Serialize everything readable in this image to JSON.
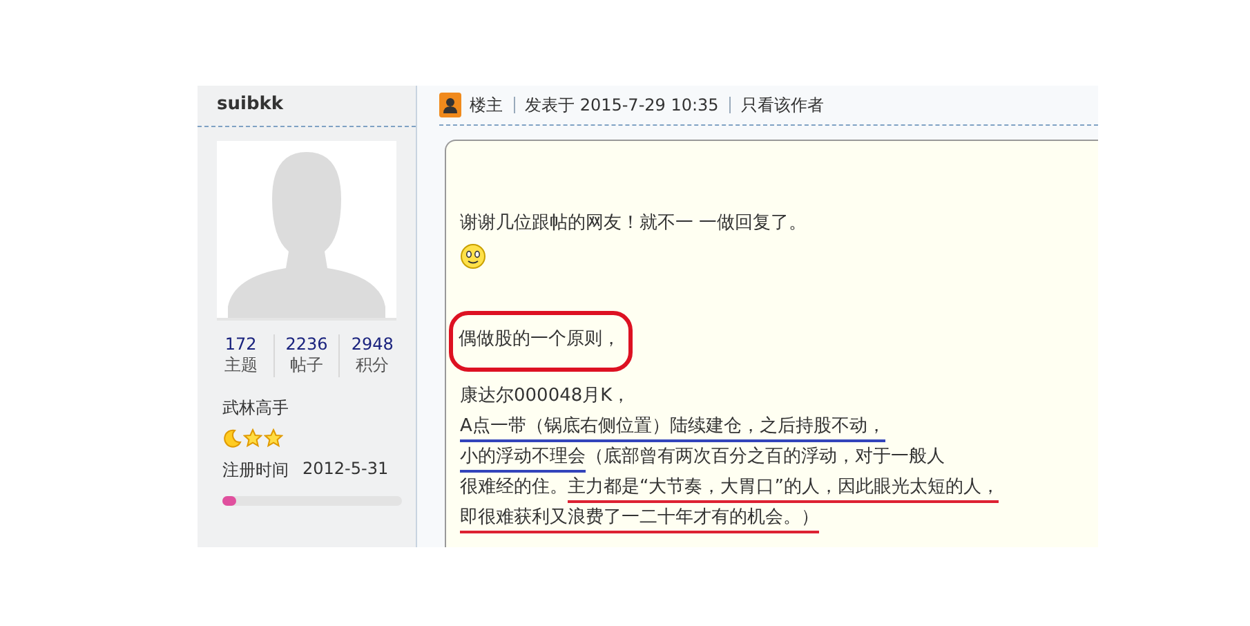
{
  "author": {
    "name": "suibkk",
    "stats": [
      {
        "value": "172",
        "label": "主题"
      },
      {
        "value": "2236",
        "label": "帖子"
      },
      {
        "value": "2948",
        "label": "积分"
      }
    ],
    "rank": "武林高手",
    "rank_icons": [
      {
        "kind": "moon"
      },
      {
        "kind": "star"
      },
      {
        "kind": "star"
      }
    ],
    "register_label": "注册时间",
    "register_date": "2012-5-31",
    "level": 0.08
  },
  "post": {
    "role": "楼主",
    "posted": "发表于 2015-7-29 10:35",
    "author_only": "只看该作者",
    "paragraphs": [
      {
        "kind": "text",
        "circled": false,
        "lines": [
          [
            {
              "text": "谢谢几位跟帖的网友！就不一 一做回复了。",
              "underline": false
            }
          ]
        ]
      },
      {
        "kind": "smiley"
      },
      {
        "kind": "text",
        "circled": true,
        "lines": [
          [
            {
              "text": "偶做股的一个原则，",
              "underline": false
            }
          ]
        ]
      },
      {
        "kind": "text",
        "circled": false,
        "lines": [
          [
            {
              "text": "康达尔000048月K，",
              "underline": false
            }
          ],
          [
            {
              "text": "A点一带（锅底右侧位置）陆续建仓，之后持股不动，",
              "underline": true,
              "color": "#3344bb"
            }
          ],
          [
            {
              "text": "小的浮动不理会",
              "underline": true,
              "color": "#3344bb"
            },
            {
              "text": "（底部曾有两次百分之百的浮动，对于一般人",
              "underline": false
            }
          ],
          [
            {
              "text": "很难经的住。",
              "underline": false
            },
            {
              "text": "主力都是“大节奏，大胃口”的人，因此眼光太短的人，",
              "underline": true,
              "color": "#dd2233"
            }
          ],
          [
            {
              "text": "即很难获利又浪费了一二十年才有的机会。）",
              "underline": true,
              "color": "#dd2233"
            }
          ]
        ]
      }
    ]
  }
}
